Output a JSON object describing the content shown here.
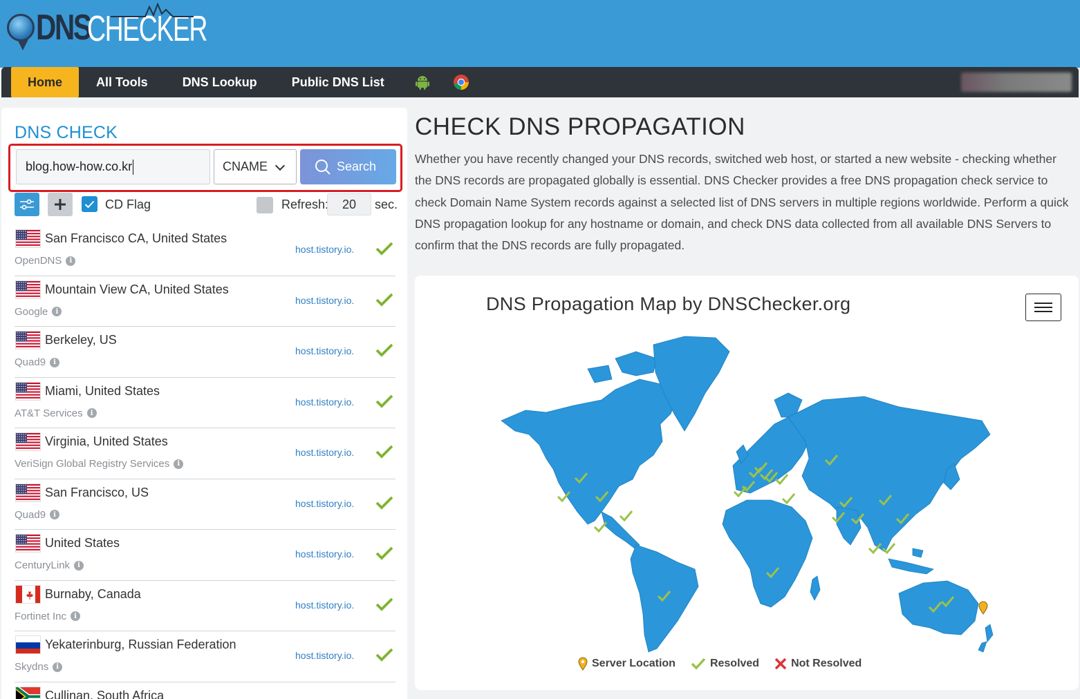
{
  "logo": {
    "part1": "DNS",
    "part2": "CHECKER"
  },
  "nav": {
    "items": [
      {
        "label": "Home",
        "active": true
      },
      {
        "label": "All Tools"
      },
      {
        "label": "DNS Lookup"
      },
      {
        "label": "Public DNS List"
      }
    ],
    "icons": [
      "android-icon",
      "chrome-icon"
    ]
  },
  "dns_check": {
    "title": "DNS CHECK",
    "domain_value": "blog.how-how.co.kr",
    "record_type": "CNAME",
    "search_label": "Search",
    "cd_flag_label": "CD Flag",
    "cd_flag_checked": true,
    "refresh_label": "Refresh:",
    "refresh_value": "20",
    "refresh_unit": "sec.",
    "refresh_checked": false
  },
  "servers": [
    {
      "location": "San Francisco CA, United States",
      "provider": "OpenDNS",
      "result": "host.tistory.io.",
      "flag": "us"
    },
    {
      "location": "Mountain View CA, United States",
      "provider": "Google",
      "result": "host.tistory.io.",
      "flag": "us"
    },
    {
      "location": "Berkeley, US",
      "provider": "Quad9",
      "result": "host.tistory.io.",
      "flag": "us"
    },
    {
      "location": "Miami, United States",
      "provider": "AT&T Services",
      "result": "host.tistory.io.",
      "flag": "us"
    },
    {
      "location": "Virginia, United States",
      "provider": "VeriSign Global Registry Services",
      "result": "host.tistory.io.",
      "flag": "us"
    },
    {
      "location": "San Francisco, US",
      "provider": "Quad9",
      "result": "host.tistory.io.",
      "flag": "us"
    },
    {
      "location": "United States",
      "provider": "CenturyLink",
      "result": "host.tistory.io.",
      "flag": "us"
    },
    {
      "location": "Burnaby, Canada",
      "provider": "Fortinet Inc",
      "result": "host.tistory.io.",
      "flag": "ca"
    },
    {
      "location": "Yekaterinburg, Russian Federation",
      "provider": "Skydns",
      "result": "host.tistory.io.",
      "flag": "ru"
    },
    {
      "location": "Cullinan, South Africa",
      "provider": "",
      "result": "",
      "flag": "za"
    }
  ],
  "main": {
    "title": "CHECK DNS PROPAGATION",
    "intro": "Whether you have recently changed your DNS records, switched web host, or started a new website - checking whether the DNS records are propagated globally is essential. DNS Checker provides a free DNS propagation check service to check Domain Name System records against a selected list of DNS servers in multiple regions worldwide. Perform a quick DNS propagation lookup for any hostname or domain, and check DNS data collected from all available DNS Servers to confirm that the DNS records are fully propagated."
  },
  "map": {
    "title": "DNS Propagation Map by DNSChecker.org",
    "legend": {
      "server_location": "Server Location",
      "resolved": "Resolved",
      "not_resolved": "Not Resolved"
    },
    "colors": {
      "land": "#2b96d9",
      "resolved": "#9bc24b",
      "not_resolved": "#d9353b",
      "marker": "#f2b01e"
    }
  }
}
